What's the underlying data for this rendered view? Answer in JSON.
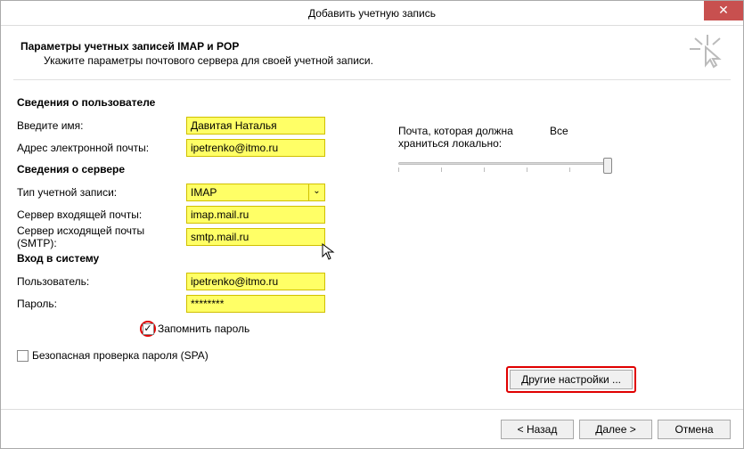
{
  "window": {
    "title": "Добавить учетную запись"
  },
  "header": {
    "title": "Параметры учетных записей IMAP и POP",
    "subtitle": "Укажите параметры почтового сервера для своей учетной записи."
  },
  "sections": {
    "user_info": "Сведения о пользователе",
    "server_info": "Сведения о сервере",
    "login": "Вход в систему"
  },
  "labels": {
    "name": "Введите имя:",
    "email": "Адрес электронной почты:",
    "account_type": "Тип учетной записи:",
    "incoming": "Сервер входящей почты:",
    "outgoing": "Сервер исходящей почты (SMTP):",
    "user": "Пользователь:",
    "password": "Пароль:",
    "remember": "Запомнить пароль",
    "spa": "Безопасная проверка пароля (SPA)"
  },
  "values": {
    "name": "Давитая Наталья",
    "email": "ipetrenko@itmo.ru",
    "account_type": "IMAP",
    "incoming": "imap.mail.ru",
    "outgoing": "smtp.mail.ru",
    "user": "ipetrenko@itmo.ru",
    "password": "********"
  },
  "right": {
    "label": "Почта, которая должна храниться локально:",
    "all": "Все"
  },
  "buttons": {
    "other_settings": "Другие настройки ...",
    "back": "< Назад",
    "next": "Далее >",
    "cancel": "Отмена"
  }
}
